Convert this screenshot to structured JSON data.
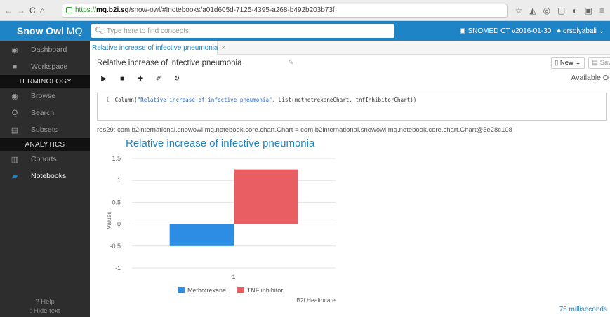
{
  "browser": {
    "url_secure": "https://",
    "url_host": "mq.b2i.sg",
    "url_path": "/snow-owl/#!notebooks/a01d605d-7125-4395-a268-b492b203b73f"
  },
  "header": {
    "brand_main": "Snow Owl",
    "brand_suffix": "MQ",
    "search_placeholder": "Type here to find concepts",
    "edition": "SNOMED CT v2016-01-30",
    "user": "orsolyabali"
  },
  "sidebar": {
    "items": [
      {
        "label": "Dashboard",
        "icon": "dashboard-icon"
      },
      {
        "label": "Workspace",
        "icon": "folder-icon"
      }
    ],
    "section_terminology": "TERMINOLOGY",
    "terminology_items": [
      {
        "label": "Browse",
        "icon": "eye-icon"
      },
      {
        "label": "Search",
        "icon": "search-icon"
      },
      {
        "label": "Subsets",
        "icon": "list-icon"
      }
    ],
    "section_analytics": "ANALYTICS",
    "analytics_items": [
      {
        "label": "Cohorts",
        "icon": "clipboard-icon"
      },
      {
        "label": "Notebooks",
        "icon": "book-icon"
      }
    ],
    "help": "Help",
    "hide_text": "Hide text"
  },
  "main": {
    "tab_label": "Relative increase of infective pneumonia",
    "notebook_title": "Relative increase of infective pneumonia",
    "new_label": "New",
    "save_label": "Save",
    "available_label": "Available O",
    "code_line_number": "1",
    "code_prefix": "Column(",
    "code_string": "\"Relative increase of infective pneumonia\"",
    "code_suffix": ", List(methotrexaneChart, tnfInhibitorChart))",
    "output": "res29: com.b2international.snowowl.mq.notebook.core.chart.Chart = com.b2international.snowowl.mq.notebook.core.chart.Chart@3e28c108",
    "execution_time": "75 milliseconds"
  },
  "chart_data": {
    "type": "bar",
    "title": "Relative increase of infective pneumonia",
    "xlabel": "",
    "ylabel": "Values",
    "categories": [
      "1"
    ],
    "ylim": [
      -1,
      1.5
    ],
    "yticks": [
      -1,
      -0.5,
      0,
      0.5,
      1,
      1.5
    ],
    "series": [
      {
        "name": "Methotrexane",
        "values": [
          -0.5
        ],
        "color": "#2d8de4"
      },
      {
        "name": "TNF inhibitor",
        "values": [
          1.25
        ],
        "color": "#e85e63"
      }
    ],
    "legend_position": "bottom",
    "credit": "B2i Healthcare",
    "grid": true
  }
}
